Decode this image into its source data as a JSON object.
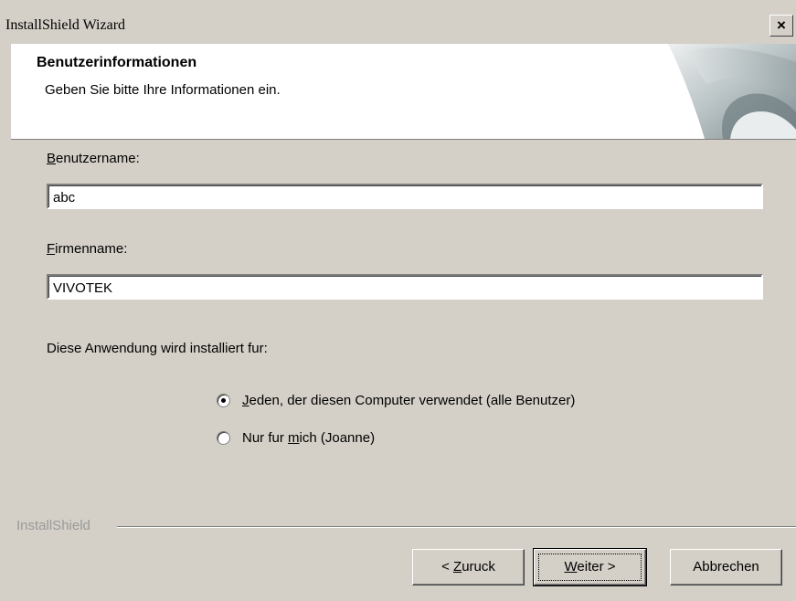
{
  "window": {
    "title": "InstallShield Wizard",
    "close_glyph": "×"
  },
  "header": {
    "title": "Benutzerinformationen",
    "subtitle": "Geben Sie bitte Ihre Informationen ein."
  },
  "form": {
    "username_label_mnemonic": "B",
    "username_label_rest": "enutzername:",
    "username_value": "abc",
    "company_label_mnemonic": "F",
    "company_label_rest": "irmenname:",
    "company_value": "VIVOTEK",
    "install_for_label": "Diese Anwendung wird installiert fur:",
    "options": [
      {
        "mnemonic": "J",
        "rest": "eden, der diesen Computer verwendet (alle Benutzer)",
        "selected": true
      },
      {
        "pre": "Nur fur ",
        "mnemonic": "m",
        "rest": "ich (Joanne)",
        "selected": false
      }
    ]
  },
  "footer": {
    "brand": "InstallShield",
    "back_pre": "< ",
    "back_mnemonic": "Z",
    "back_rest": "uruck",
    "next_mnemonic": "W",
    "next_rest": "eiter >",
    "cancel_label": "Abbrechen"
  }
}
